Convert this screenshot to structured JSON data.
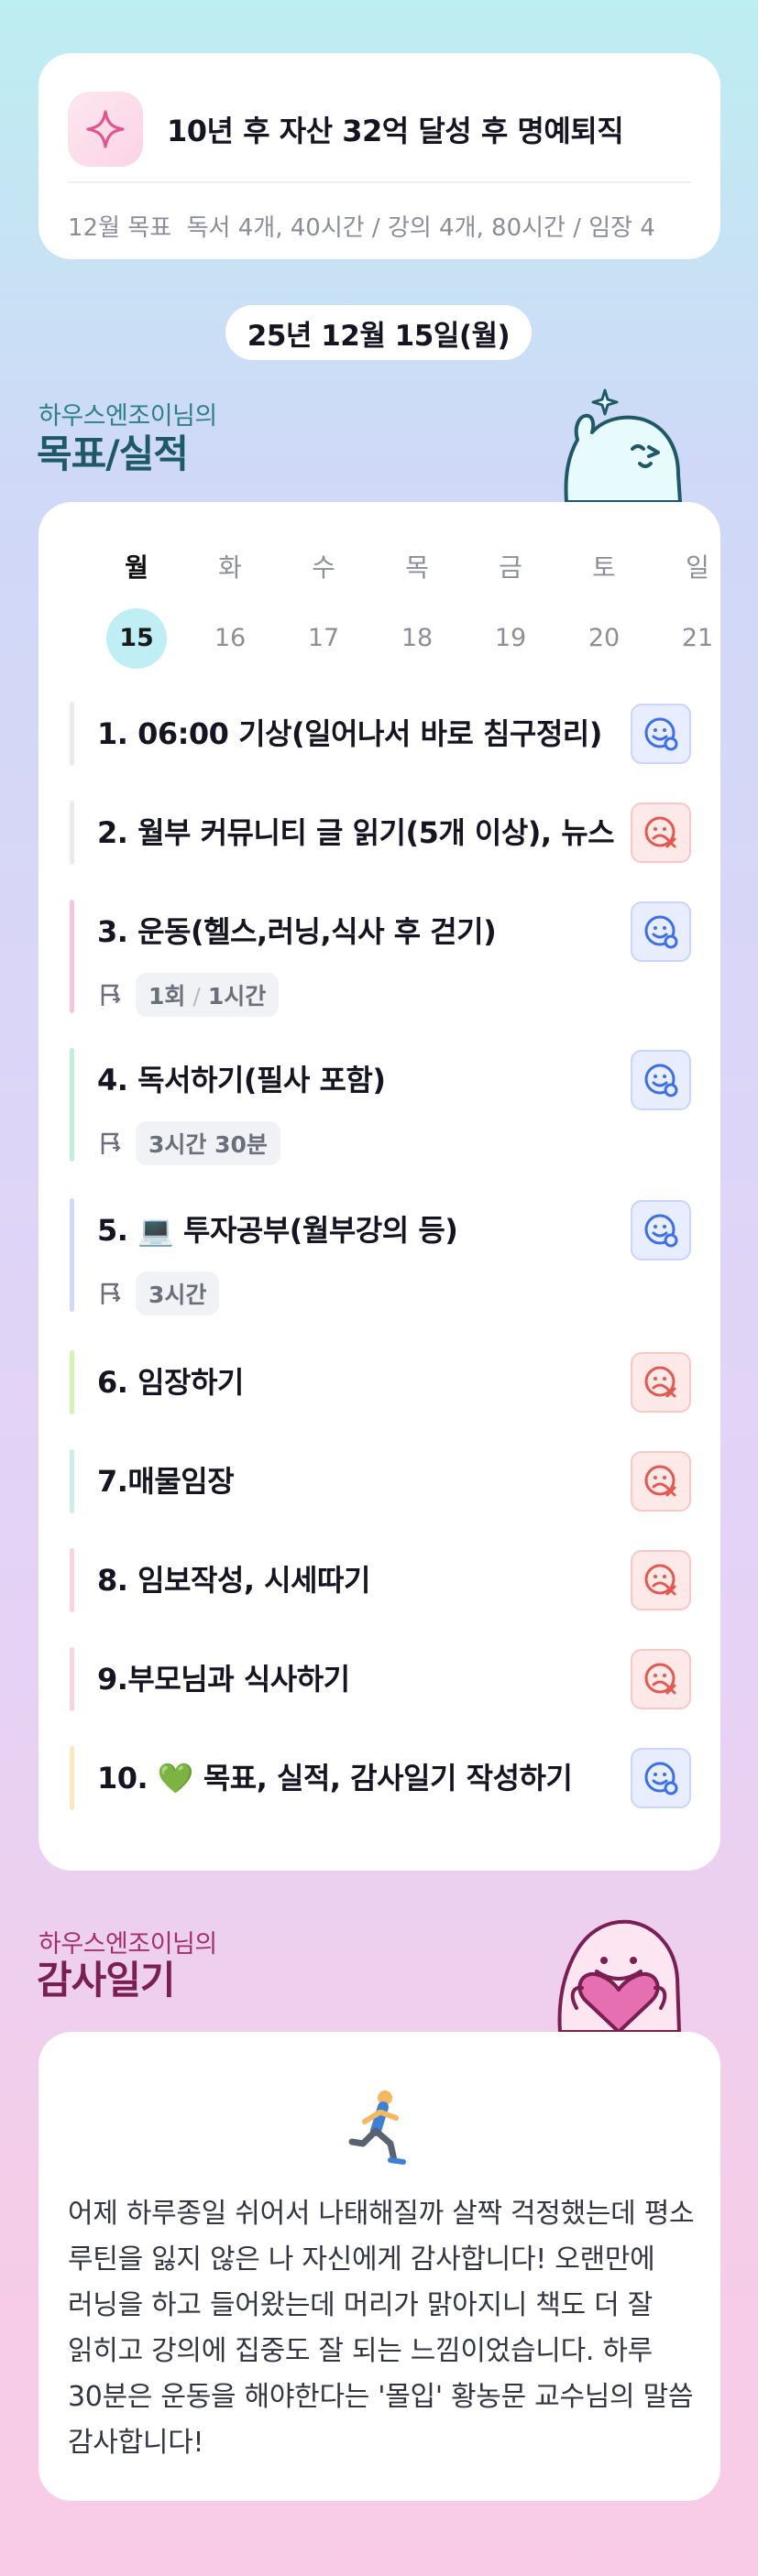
{
  "goal": {
    "icon": "sparkle-icon",
    "title": "10년 후 자산 32억 달성 후 명예퇴직",
    "month_label": "12월 목표",
    "month_text": "독서 4개, 40시간 / 강의 4개, 80시간 / 임장 4"
  },
  "date": "25년 12월 15일(월)",
  "goals_section": {
    "subtitle": "하우스엔조이님의",
    "title": "목표/실적"
  },
  "week": [
    {
      "day": "월",
      "date": "15",
      "active": true
    },
    {
      "day": "화",
      "date": "16",
      "active": false
    },
    {
      "day": "수",
      "date": "17",
      "active": false
    },
    {
      "day": "목",
      "date": "18",
      "active": false
    },
    {
      "day": "금",
      "date": "19",
      "active": false
    },
    {
      "day": "토",
      "date": "20",
      "active": false
    },
    {
      "day": "일",
      "date": "21",
      "active": false
    }
  ],
  "items": [
    {
      "title": "1. 06:00 기상(일어나서 바로 침구정리)",
      "status": "done",
      "color": "#e9e9ee"
    },
    {
      "title": "2. 월부 커뮤니티 글 읽기(5개 이상), 뉴스",
      "status": "fail",
      "color": "#e9e9ee"
    },
    {
      "title": "3. 운동(헬스,러닝,식사 후 걷기)",
      "status": "done",
      "color": "#f7c6de",
      "tag_a": "1회",
      "tag_sep": "/",
      "tag_b": "1시간"
    },
    {
      "title": "4. 독서하기(필사 포함)",
      "status": "done",
      "color": "#bfeed9",
      "tag_a": "3시간 30분"
    },
    {
      "title": "5. 💻 투자공부(월부강의 등)",
      "status": "done",
      "color": "#cfd9fb",
      "tag_a": "3시간"
    },
    {
      "title": "6. 임장하기",
      "status": "fail",
      "color": "#d6f2b4"
    },
    {
      "title": "7.매물임장",
      "status": "fail",
      "color": "#cdeeea"
    },
    {
      "title": "8. 임보작성, 시세따기",
      "status": "fail",
      "color": "#fbd3d8"
    },
    {
      "title": "9.부모님과 식사하기",
      "status": "fail",
      "color": "#fbd3d8"
    },
    {
      "title": "10. 💚 목표, 실적, 감사일기 작성하기",
      "status": "done",
      "color": "#fde7bf"
    }
  ],
  "gratitude_section": {
    "subtitle": "하우스엔조이님의",
    "title": "감사일기"
  },
  "diary": {
    "emoji": "runner-icon",
    "text": "어제 하루종일 쉬어서 나태해질까 살짝 걱정했는데 평소 루틴을 잃지 않은 나 자신에게 감사합니다! 오랜만에 러닝을 하고 들어왔는데 머리가 맑아지니 책도 더 잘 읽히고 강의에 집중도 잘 되는 느낌이었습니다. 하루 30분은 운동을 해야한다는 '몰입' 황농문 교수님의 말씀 감사합니다!"
  }
}
